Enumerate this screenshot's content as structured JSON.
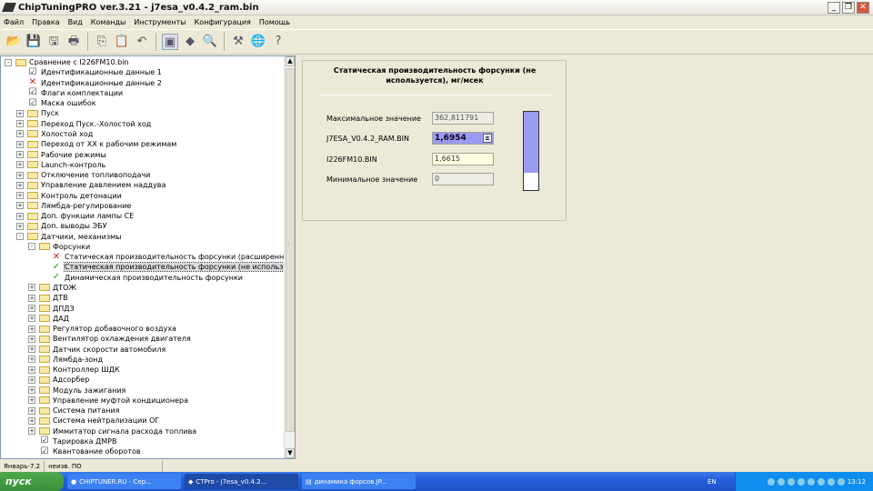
{
  "window": {
    "title": "ChipTuningPRO ver.3.21 - j7esa_v0.4.2_ram.bin",
    "min": "_",
    "max": "❐",
    "close": "✕"
  },
  "menu": [
    "Файл",
    "Правка",
    "Вид",
    "Команды",
    "Инструменты",
    "Конфигурация",
    "Помощь"
  ],
  "toolbar": [
    {
      "icon": "open-icon",
      "glyph": "📂"
    },
    {
      "icon": "save-icon",
      "glyph": "💾"
    },
    {
      "icon": "save-as-icon",
      "glyph": "🖫"
    },
    {
      "icon": "print-icon",
      "glyph": "🖶"
    },
    {
      "sep": true
    },
    {
      "icon": "copy-icon",
      "glyph": "⎘"
    },
    {
      "icon": "paste-icon",
      "glyph": "📋"
    },
    {
      "icon": "undo-icon",
      "glyph": "↶"
    },
    {
      "sep": true
    },
    {
      "icon": "chart-icon",
      "glyph": "▣",
      "on": true
    },
    {
      "icon": "info-icon",
      "glyph": "◆"
    },
    {
      "icon": "search-icon",
      "glyph": "🔍"
    },
    {
      "sep": true
    },
    {
      "icon": "tools-icon",
      "glyph": "⚒"
    },
    {
      "icon": "network-icon",
      "glyph": "🌐"
    },
    {
      "icon": "help-icon",
      "glyph": "?"
    }
  ],
  "tree": [
    {
      "l": 0,
      "e": "-",
      "i": "folder",
      "t": "Сравнение с I226FM10.bin"
    },
    {
      "l": 1,
      "i": "doc",
      "t": "Идентификационные данные 1"
    },
    {
      "l": 1,
      "i": "x",
      "t": "Идентификационные данные 2"
    },
    {
      "l": 1,
      "i": "doc",
      "t": "Флаги комплектации"
    },
    {
      "l": 1,
      "i": "doc",
      "t": "Маска ошибок"
    },
    {
      "l": 1,
      "e": "+",
      "i": "folder",
      "t": "Пуск"
    },
    {
      "l": 1,
      "e": "+",
      "i": "folder",
      "t": "Переход Пуск.-Холостой ход"
    },
    {
      "l": 1,
      "e": "+",
      "i": "folder",
      "t": "Холостой ход"
    },
    {
      "l": 1,
      "e": "+",
      "i": "folder",
      "t": "Переход от ХХ к рабочим режимам"
    },
    {
      "l": 1,
      "e": "+",
      "i": "folder",
      "t": "Рабочие режимы"
    },
    {
      "l": 1,
      "e": "+",
      "i": "folder",
      "t": "Launch-контроль"
    },
    {
      "l": 1,
      "e": "+",
      "i": "folder",
      "t": "Отключение топливоподачи"
    },
    {
      "l": 1,
      "e": "+",
      "i": "folder",
      "t": "Управление давлением наддува"
    },
    {
      "l": 1,
      "e": "+",
      "i": "folder",
      "t": "Контроль детонации"
    },
    {
      "l": 1,
      "e": "+",
      "i": "folder",
      "t": "Лямбда-регулирование"
    },
    {
      "l": 1,
      "e": "+",
      "i": "folder",
      "t": "Доп. функции лампы CE"
    },
    {
      "l": 1,
      "e": "+",
      "i": "folder",
      "t": "Доп. выводы ЭБУ"
    },
    {
      "l": 1,
      "e": "-",
      "i": "folder",
      "t": "Датчики, механизмы"
    },
    {
      "l": 2,
      "e": "-",
      "i": "folder",
      "t": "Форсунки"
    },
    {
      "l": 3,
      "i": "x",
      "t": "Статическая производительность форсунки (расширенная)"
    },
    {
      "l": 3,
      "i": "ok",
      "t": "Статическая производительность форсунки (не используется)",
      "sel": true
    },
    {
      "l": 3,
      "i": "ok",
      "t": "Динамическая производительность форсунки"
    },
    {
      "l": 2,
      "e": "+",
      "i": "folder",
      "t": "ДТОЖ"
    },
    {
      "l": 2,
      "e": "+",
      "i": "folder",
      "t": "ДТВ"
    },
    {
      "l": 2,
      "e": "+",
      "i": "folder",
      "t": "ДПДЗ"
    },
    {
      "l": 2,
      "e": "+",
      "i": "folder",
      "t": "ДАД"
    },
    {
      "l": 2,
      "e": "+",
      "i": "folder",
      "t": "Регулятор добавочного воздуха"
    },
    {
      "l": 2,
      "e": "+",
      "i": "folder",
      "t": "Вентилятор охлаждения двигателя"
    },
    {
      "l": 2,
      "e": "+",
      "i": "folder",
      "t": "Датчик скорости автомобиля"
    },
    {
      "l": 2,
      "e": "+",
      "i": "folder",
      "t": "Лямбда-зонд"
    },
    {
      "l": 2,
      "e": "+",
      "i": "folder",
      "t": "Контроллер ШДК"
    },
    {
      "l": 2,
      "e": "+",
      "i": "folder",
      "t": "Адсорбер"
    },
    {
      "l": 2,
      "e": "+",
      "i": "folder",
      "t": "Модуль зажигания"
    },
    {
      "l": 2,
      "e": "+",
      "i": "folder",
      "t": "Управление муфтой кондиционера"
    },
    {
      "l": 2,
      "e": "+",
      "i": "folder",
      "t": "Система питания"
    },
    {
      "l": 2,
      "e": "+",
      "i": "folder",
      "t": "Система нейтрализации ОГ"
    },
    {
      "l": 2,
      "e": "+",
      "i": "folder",
      "t": "Иммитатор сигнала расхода топлива"
    },
    {
      "l": 2,
      "i": "doc",
      "t": "Тарировка ДМРВ"
    },
    {
      "l": 2,
      "i": "doc",
      "t": "Квантование оборотов"
    }
  ],
  "panel": {
    "title": "Статическая производительность форсунки (не используется), мг/мсек",
    "max_label": "Максимальное значение",
    "max_value": "362,811791",
    "cur_label": "J7ESA_V0.4.2_RAM.BIN",
    "cur_value": "1,6954",
    "cmp_label": "I226FM10.BIN",
    "cmp_value": "1,6615",
    "min_label": "Минимальное значение",
    "min_value": "0",
    "gauge_fill_percent": 78,
    "gauge_color": "#9b9bf2"
  },
  "status": [
    "Январь-7.2",
    "неизв. ПО"
  ],
  "taskbar": {
    "start": "пуск",
    "tasks": [
      "CHIPTUNER.RU - Сер...",
      "CTPro - j7esa_v0.4.2...",
      "динамика форсов.JP..."
    ],
    "lang": "EN",
    "clock": "13:12"
  }
}
